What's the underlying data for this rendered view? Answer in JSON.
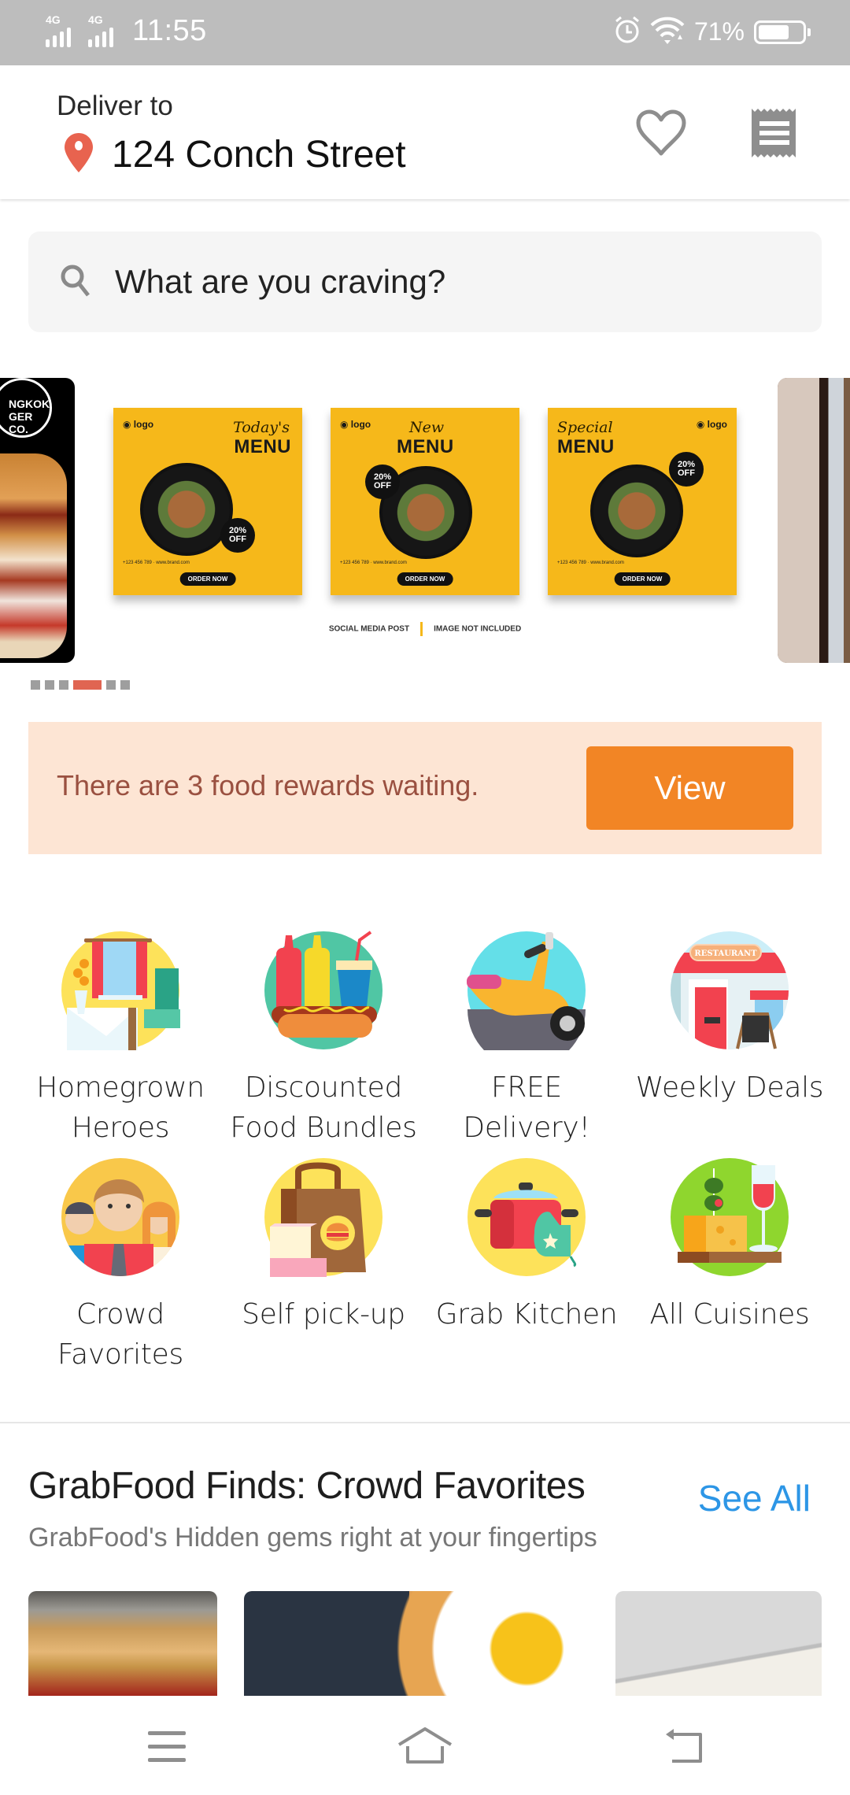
{
  "status_bar": {
    "network_1": "4G",
    "network_2": "4G",
    "time": "11:55",
    "battery_percent_label": "71%",
    "battery_level": 0.71,
    "icons": [
      "signal-4g-icon",
      "signal-4g-icon",
      "alarm-icon",
      "wifi-icon",
      "battery-icon"
    ]
  },
  "header": {
    "deliver_label": "Deliver to",
    "address": "124 Conch Street",
    "icons": [
      "location-pin-icon",
      "heart-icon",
      "receipt-icon"
    ],
    "pin_color": "#e8634f"
  },
  "search": {
    "placeholder": "What are you craving?",
    "icon": "search-icon"
  },
  "carousel": {
    "slides": [
      {
        "name": "burger-promo",
        "logo_text_line1": "NGKOK",
        "logo_text_line2": "GER CO."
      },
      {
        "name": "menu-promo",
        "cards": [
          {
            "logo": "◉ logo",
            "script": "Today's",
            "title": "MENU",
            "badge": "20% OFF",
            "order": "ORDER NOW",
            "fine": "+123 456 789 · www.brand.com"
          },
          {
            "logo": "◉ logo",
            "script": "New",
            "title": "MENU",
            "badge": "20% OFF",
            "order": "ORDER NOW",
            "fine": "+123 456 789 · www.brand.com"
          },
          {
            "logo": "◉ logo",
            "script": "Special",
            "title": "MENU",
            "badge": "20% OFF",
            "order": "ORDER NOW",
            "fine": "+123 456 789 · www.brand.com"
          }
        ],
        "caption_left": "SOCIAL MEDIA POST",
        "caption_right": "IMAGE NOT INCLUDED"
      },
      {
        "name": "restaurant-photo"
      }
    ],
    "dot_count": 6,
    "active_dot": 3,
    "active_color": "#e06552"
  },
  "rewards": {
    "text": "There are 3 food rewards waiting.",
    "button_label": "View",
    "bg_color": "#fde5d4",
    "button_color": "#f28525"
  },
  "categories": [
    {
      "label": "Homegrown Heroes",
      "line1": "Homegrown",
      "line2": "Heroes",
      "icon": "home-interior-icon"
    },
    {
      "label": "Discounted Food Bundles",
      "line1": "Discounted",
      "line2": "Food Bundles",
      "icon": "hotdog-bundle-icon"
    },
    {
      "label": "FREE Delivery!",
      "line1": "FREE",
      "line2": "Delivery!",
      "icon": "scooter-icon"
    },
    {
      "label": "Weekly Deals",
      "line1": "Weekly Deals",
      "line2": "",
      "icon": "restaurant-storefront-icon",
      "sign_text": "RESTAURANT"
    },
    {
      "label": "Crowd Favorites",
      "line1": "Crowd",
      "line2": "Favorites",
      "icon": "crowd-people-icon"
    },
    {
      "label": "Self pick-up",
      "line1": "Self pick-up",
      "line2": "",
      "icon": "takeaway-bag-icon"
    },
    {
      "label": "Grab Kitchen",
      "line1": "Grab Kitchen",
      "line2": "",
      "icon": "cooking-pot-icon"
    },
    {
      "label": "All Cuisines",
      "line1": "All Cuisines",
      "line2": "",
      "icon": "cheese-wine-icon"
    }
  ],
  "section": {
    "title": "GrabFood Finds: Crowd Favorites",
    "see_all": "See All",
    "subtitle": "GrabFood's Hidden gems right at your fingertips",
    "link_color": "#2d96e6",
    "cards": [
      {
        "name": "sliders-burger-photo"
      },
      {
        "name": "fried-egg-photo"
      },
      {
        "name": "chicken-plate-photo"
      }
    ]
  },
  "navbar": {
    "icons": [
      "menu-icon",
      "home-icon",
      "back-icon"
    ]
  }
}
